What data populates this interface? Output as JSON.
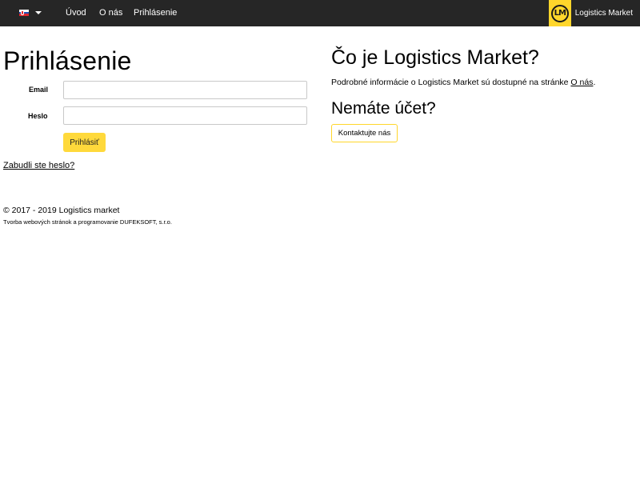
{
  "navbar": {
    "language": {
      "flag": "slovak-flag-icon",
      "caret": "caret-down-icon"
    },
    "links": [
      {
        "label": "Úvod"
      },
      {
        "label": "O nás"
      },
      {
        "label": "Prihlásenie"
      }
    ],
    "brand": {
      "logo_text": "LM",
      "name": "Logistics Market",
      "logo_color": "#ffd62b"
    },
    "background": "#262626"
  },
  "login": {
    "title": "Prihlásenie",
    "email_label": "Email",
    "email_value": "",
    "password_label": "Heslo",
    "password_value": "",
    "submit_label": "Prihlásiť",
    "forgot_link": "Zabudli ste heslo?"
  },
  "info": {
    "title": "Čo je Logistics Market?",
    "text_prefix": "Podrobné informácie o Logistics Market sú dostupné na stránke ",
    "text_link": "O nás",
    "text_suffix": ".",
    "no_account_title": "Nemáte účet?",
    "contact_button": "Kontaktujte nás"
  },
  "footer": {
    "copyright": "© 2017 - 2019 Logistics market",
    "credit": "Tvorba webových stránok a programovanie DUFEKSOFT, s.r.o."
  },
  "colors": {
    "accent": "#ffd93b"
  }
}
